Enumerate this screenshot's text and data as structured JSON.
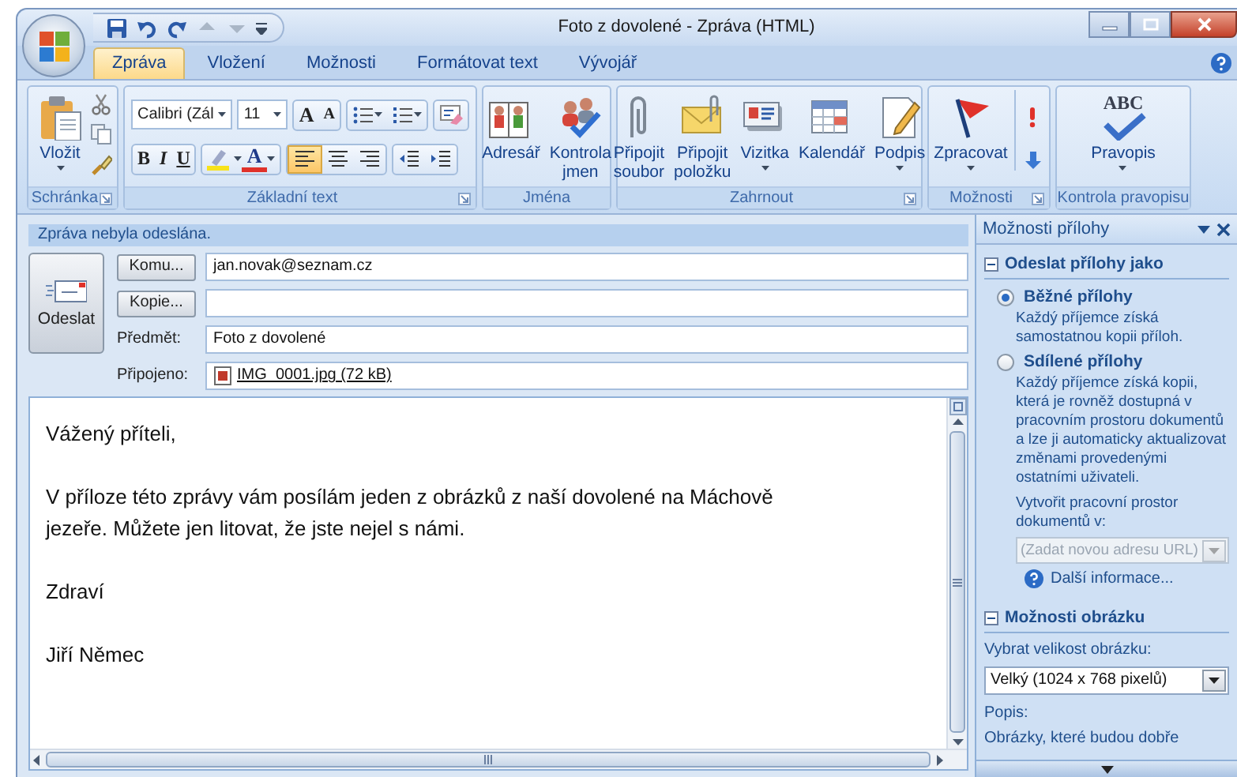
{
  "window": {
    "title": "Foto z dovolené - Zpráva (HTML)"
  },
  "tabs": [
    {
      "label": "Zpráva",
      "selected": true
    },
    {
      "label": "Vložení",
      "selected": false
    },
    {
      "label": "Možnosti",
      "selected": false
    },
    {
      "label": "Formátovat text",
      "selected": false
    },
    {
      "label": "Vývojář",
      "selected": false
    }
  ],
  "ribbon": {
    "groups": [
      {
        "kind": "clipboard",
        "label": "Schránka",
        "launcher": true,
        "buttons": [
          {
            "label": "Vložit",
            "dropdown": true
          }
        ]
      },
      {
        "kind": "font",
        "label": "Základní text",
        "launcher": true,
        "font": "Calibri (Zál",
        "size": "11",
        "size_buttons": [
          "A",
          "A"
        ],
        "format_buttons": [
          "B",
          "I",
          "U"
        ],
        "font_color": "A",
        "alignment": [
          {
            "selected": true
          },
          {
            "selected": false
          },
          {
            "selected": false
          }
        ]
      },
      {
        "kind": "names",
        "label": "Jména",
        "launcher": false,
        "buttons": [
          {
            "label": "Adresář",
            "dropdown": false
          },
          {
            "label": "Kontrola jmen",
            "dropdown": false
          }
        ]
      },
      {
        "kind": "include",
        "label": "Zahrnout",
        "launcher": true,
        "buttons": [
          {
            "label": "Připojit soubor",
            "dropdown": false
          },
          {
            "label": "Připojit položku",
            "dropdown": false
          },
          {
            "label": "Vizitka",
            "dropdown": true
          },
          {
            "label": "Kalendář",
            "dropdown": false
          },
          {
            "label": "Podpis",
            "dropdown": true
          }
        ]
      },
      {
        "kind": "options",
        "label": "Možnosti",
        "launcher": true,
        "buttons": [
          {
            "label": "Zpracovat",
            "dropdown": true
          }
        ]
      },
      {
        "kind": "proofing",
        "label": "Kontrola pravopisu",
        "launcher": false,
        "buttons": [
          {
            "label": "Pravopis",
            "dropdown": true,
            "icon_text": "ABC"
          }
        ]
      }
    ]
  },
  "compose": {
    "info_bar": "Zpráva nebyla odeslána.",
    "send_button": "Odeslat",
    "fields": [
      {
        "kind": "button",
        "label": "Komu...",
        "value": "jan.novak@seznam.cz"
      },
      {
        "kind": "button",
        "label": "Kopie..."
      },
      {
        "kind": "label",
        "label": "Předmět:",
        "value": "Foto z dovolené"
      },
      {
        "kind": "attachment",
        "label": "Připojeno:",
        "value": "IMG_0001.jpg (72 kB)"
      }
    ],
    "body": [
      "Vážený příteli,",
      "V příloze této zprávy vám posílám jeden z obrázků z naší dovolené na Máchově jezeře. Můžete jen litovat, že jste nejel s námi.",
      "Zdraví",
      "Jiří Němec"
    ]
  },
  "task_pane": {
    "title": "Možnosti přílohy",
    "sections": [
      {
        "kind": "attach",
        "title": "Odeslat přílohy jako",
        "expanded": true,
        "options": [
          {
            "label": "Běžné přílohy",
            "selected": true,
            "description": "Každý příjemce získá samostatnou kopii příloh."
          },
          {
            "label": "Sdílené přílohy",
            "selected": false,
            "description": "Každý příjemce získá kopii, která je rovněž dostupná v pracovním prostoru dokumentů a lze ji automaticky aktualizovat změnami provedenými ostatními uživateli."
          }
        ],
        "workspace_label": "Vytvořit pracovní prostor dokumentů v:",
        "workspace_placeholder": "(Zadat novou adresu URL)",
        "workspace_disabled": true,
        "more_link": "Další informace..."
      },
      {
        "kind": "picture",
        "title": "Možnosti obrázku",
        "expanded": true,
        "size_label": "Vybrat velikost obrázku:",
        "size_value": "Velký (1024 x 768 pixelů)",
        "caption_label": "Popis:",
        "caption_text": "Obrázky, které budou dobře"
      }
    ]
  }
}
